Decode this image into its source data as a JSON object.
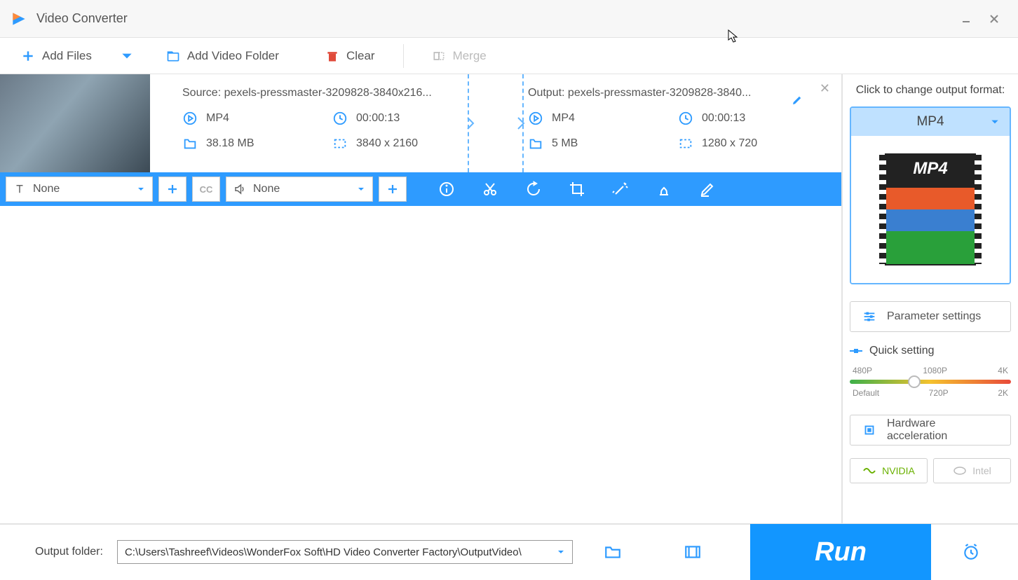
{
  "app_title": "Video Converter",
  "toolbar": {
    "add_files": "Add Files",
    "add_folder": "Add Video Folder",
    "clear": "Clear",
    "merge": "Merge"
  },
  "file": {
    "source_label": "Source: pexels-pressmaster-3209828-3840x216...",
    "output_label": "Output: pexels-pressmaster-3209828-3840...",
    "src": {
      "format": "MP4",
      "duration": "00:00:13",
      "size": "38.18 MB",
      "resolution": "3840 x 2160"
    },
    "out": {
      "format": "MP4",
      "duration": "00:00:13",
      "size": "5 MB",
      "resolution": "1280 x 720"
    }
  },
  "actionbar": {
    "subtitle_dd": "None",
    "audio_dd": "None"
  },
  "right": {
    "hint": "Click to change output format:",
    "format_name": "MP4",
    "format_strip": "MP4",
    "param_btn": "Parameter settings",
    "quick_label": "Quick setting",
    "ticks_top": [
      "480P",
      "1080P",
      "4K"
    ],
    "ticks_bot": [
      "Default",
      "720P",
      "2K"
    ],
    "hw_btn": "Hardware acceleration",
    "nvidia": "NVIDIA",
    "intel": "Intel"
  },
  "bottom": {
    "label": "Output folder:",
    "path": "C:\\Users\\Tashreef\\Videos\\WonderFox Soft\\HD Video Converter Factory\\OutputVideo\\",
    "run": "Run"
  }
}
